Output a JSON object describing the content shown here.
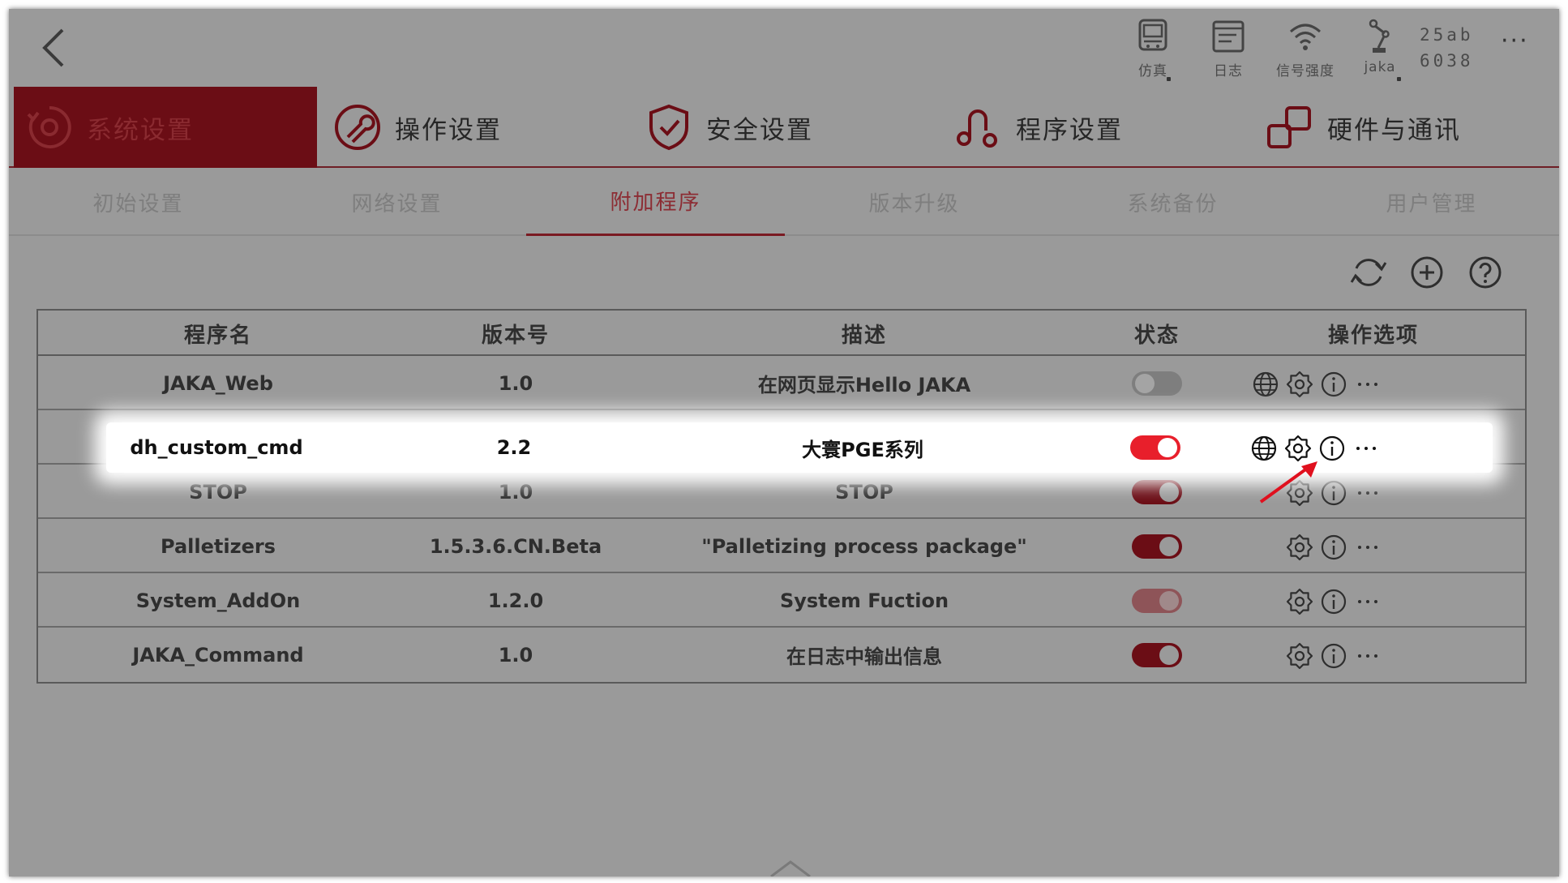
{
  "topbar": {
    "status_items": [
      {
        "label": "仿真",
        "icon": "simulation-icon"
      },
      {
        "label": "日志",
        "icon": "log-icon"
      },
      {
        "label": "信号强度",
        "icon": "wifi-icon"
      },
      {
        "label": "jaka",
        "icon": "robot-arm-icon"
      }
    ],
    "id_line1": "25ab",
    "id_line2": "6038",
    "more": "···"
  },
  "main_tabs": [
    {
      "label": "系统设置",
      "icon": "system-settings-icon",
      "active": true
    },
    {
      "label": "操作设置",
      "icon": "operation-settings-icon"
    },
    {
      "label": "安全设置",
      "icon": "safety-shield-icon"
    },
    {
      "label": "程序设置",
      "icon": "program-settings-icon"
    },
    {
      "label": "硬件与通讯",
      "icon": "hardware-comm-icon"
    }
  ],
  "sub_tabs": [
    {
      "label": "初始设置"
    },
    {
      "label": "网络设置"
    },
    {
      "label": "附加程序",
      "active": true
    },
    {
      "label": "版本升级"
    },
    {
      "label": "系统备份"
    },
    {
      "label": "用户管理"
    }
  ],
  "toolbar": [
    "refresh-icon",
    "add-icon",
    "help-icon"
  ],
  "table": {
    "headers": [
      "程序名",
      "版本号",
      "描述",
      "状态",
      "操作选项"
    ],
    "rows": [
      {
        "name": "JAKA_Web",
        "version": "1.0",
        "description": "在网页显示Hello JAKA",
        "state": "off",
        "web": true
      },
      {
        "name": "dh_custom_cmd",
        "version": "2.2",
        "description": "大寰PGE系列",
        "state": "on",
        "web": true,
        "highlighted": true
      },
      {
        "name": "STOP",
        "version": "1.0",
        "description": "STOP",
        "state": "on",
        "web": false
      },
      {
        "name": "Palletizers",
        "version": "1.5.3.6.CN.Beta",
        "description": "\"Palletizing process package\"",
        "state": "on",
        "web": false
      },
      {
        "name": "System_AddOn",
        "version": "1.2.0",
        "description": "System Fuction",
        "state": "disabled",
        "web": false
      },
      {
        "name": "JAKA_Command",
        "version": "1.0",
        "description": "在日志中输出信息",
        "state": "on",
        "web": false
      }
    ],
    "ops_icons": [
      "globe-icon",
      "gear-icon",
      "info-icon",
      "more-icon"
    ],
    "more_glyph": "···"
  },
  "colors": {
    "accent": "#e81f2b",
    "dim_overlay": "#9a9a9a",
    "active_tab_bg": "#6b0d15",
    "arrow": "#e0101e"
  }
}
